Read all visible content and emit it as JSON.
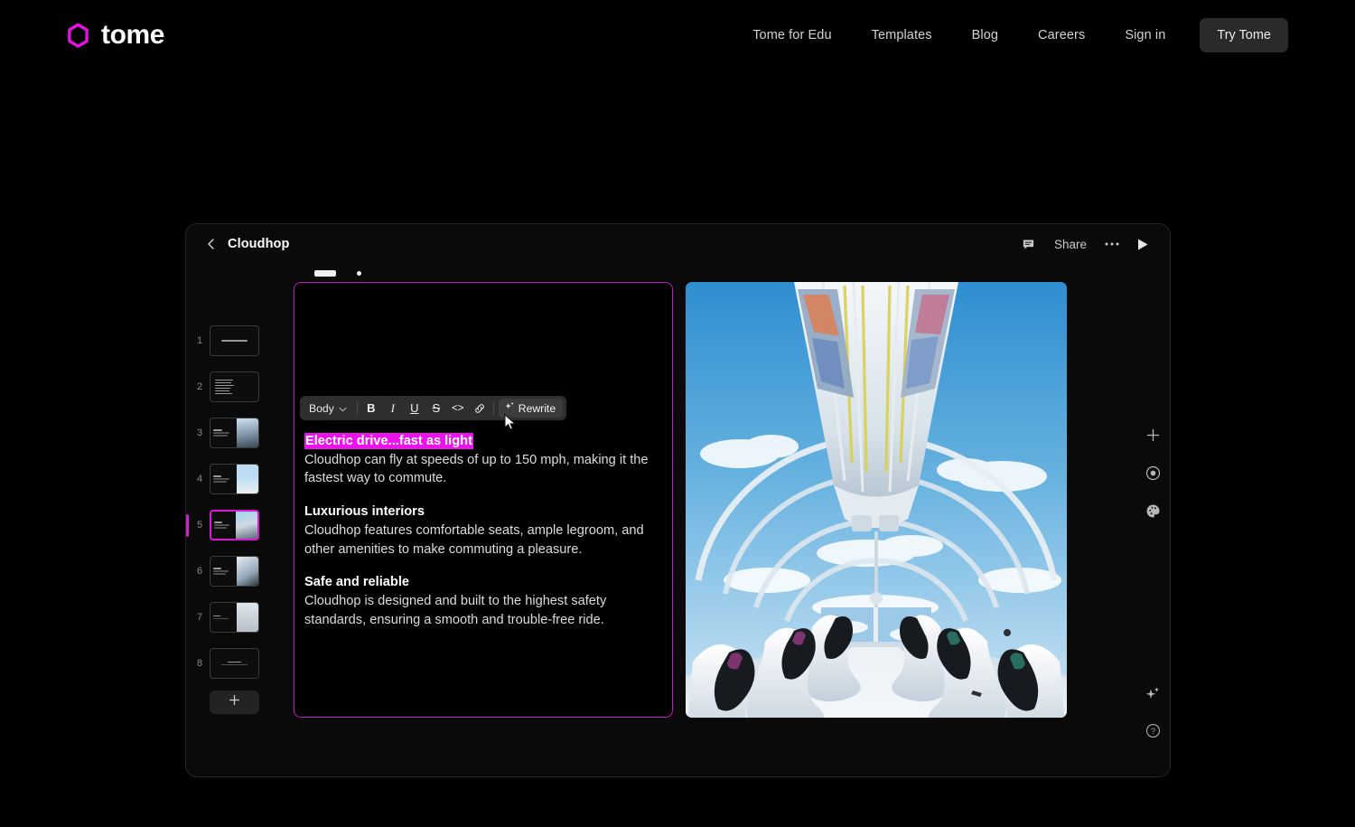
{
  "site_nav": {
    "brand": {
      "name": "tome",
      "icon": "tome-hexagon-logo",
      "color": "#e312e3"
    },
    "links": [
      {
        "label": "Tome for Edu",
        "name": "nav-link-tome-for-edu"
      },
      {
        "label": "Templates",
        "name": "nav-link-templates"
      },
      {
        "label": "Blog",
        "name": "nav-link-blog"
      },
      {
        "label": "Careers",
        "name": "nav-link-careers"
      },
      {
        "label": "Sign in",
        "name": "nav-link-sign-in"
      }
    ],
    "cta": {
      "label": "Try Tome",
      "name": "try-tome-button"
    }
  },
  "app": {
    "header": {
      "back_icon": "chevron-left-icon",
      "title": "Cloudhop",
      "comment_icon": "comment-icon",
      "share_label": "Share",
      "more_icon": "ellipsis-icon",
      "present_icon": "play-icon"
    },
    "slides": [
      {
        "number": "1",
        "layout": "title",
        "title_text": "Introducing Cloudhop"
      },
      {
        "number": "2",
        "layout": "list",
        "lines": 6
      },
      {
        "number": "3",
        "layout": "text-image",
        "image": "city-street"
      },
      {
        "number": "4",
        "layout": "text-image",
        "image": "pod-on-track"
      },
      {
        "number": "5",
        "layout": "text-image",
        "image": "pod-interior",
        "selected": true
      },
      {
        "number": "6",
        "layout": "text-image",
        "image": "pod-exterior"
      },
      {
        "number": "7",
        "layout": "text-image",
        "image": "person-in-corridor"
      },
      {
        "number": "8",
        "layout": "closing",
        "title_text": "Closing"
      }
    ],
    "add_slide": {
      "icon": "plus-icon",
      "name": "add-slide-button"
    },
    "editor": {
      "toolbar": {
        "style_label": "Body",
        "chevron": "chevron-down-icon",
        "bold": "B",
        "italic": "I",
        "underline": "U",
        "strikethrough": "S",
        "code": "<>",
        "link": "link-icon",
        "rewrite_label": "Rewrite",
        "rewrite_icon": "sparkle-icon"
      },
      "blocks": [
        {
          "heading": "Electric drive...fast as light",
          "selected": true,
          "body": "Cloudhop can fly at speeds of up to 150 mph, making it the fastest way to commute."
        },
        {
          "heading": "Luxurious interiors",
          "selected": false,
          "body": "Cloudhop features comfortable seats, ample legroom, and other amenities to make commuting a pleasure."
        },
        {
          "heading": "Safe and reliable",
          "selected": false,
          "body": "Cloudhop is designed and built to the highest safety standards, ensuring a smooth and trouble-free ride."
        }
      ],
      "selection_color": "#ec12ec",
      "block_border_color": "#c219c2"
    },
    "slide_image_alt": "Futuristic white transit pod interior with curved windows and sky",
    "tool_rail": [
      {
        "icon": "plus-icon",
        "name": "add-element-button"
      },
      {
        "icon": "record-target-icon",
        "name": "record-button"
      },
      {
        "icon": "palette-icon",
        "name": "theme-palette-button"
      }
    ],
    "tool_rail_bottom": [
      {
        "icon": "sparkle-icon",
        "name": "ai-assist-button"
      },
      {
        "icon": "help-circle-icon",
        "name": "help-button"
      }
    ]
  }
}
